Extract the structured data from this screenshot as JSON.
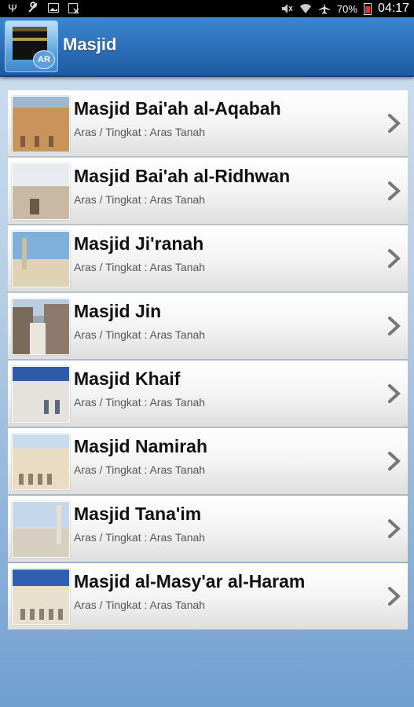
{
  "status_bar": {
    "battery": "70%",
    "time": "04:17",
    "icons": [
      "usb-icon",
      "wrench-icon",
      "image-icon",
      "calendar-x-icon",
      "mute-icon",
      "wifi-icon",
      "airplane-icon",
      "battery-icon"
    ]
  },
  "app_bar": {
    "title": "Masjid",
    "icon_badge": "AR"
  },
  "list": {
    "subtitle_label": "Aras / Tingkat : Aras Tanah",
    "items": [
      {
        "title": "Masjid Bai'ah al-Aqabah",
        "subtitle": "Aras / Tingkat : Aras Tanah"
      },
      {
        "title": "Masjid Bai'ah al-Ridhwan",
        "subtitle": "Aras / Tingkat : Aras Tanah"
      },
      {
        "title": "Masjid Ji'ranah",
        "subtitle": "Aras / Tingkat : Aras Tanah"
      },
      {
        "title": "Masjid Jin",
        "subtitle": "Aras / Tingkat : Aras Tanah"
      },
      {
        "title": "Masjid Khaif",
        "subtitle": "Aras / Tingkat : Aras Tanah"
      },
      {
        "title": "Masjid Namirah",
        "subtitle": "Aras / Tingkat : Aras Tanah"
      },
      {
        "title": "Masjid Tana'im",
        "subtitle": "Aras / Tingkat : Aras Tanah"
      },
      {
        "title": "Masjid al-Masy'ar al-Haram",
        "subtitle": "Aras / Tingkat : Aras Tanah"
      }
    ]
  },
  "colors": {
    "app_bar": "#2a6fb8",
    "status_bar": "#000000",
    "background": "#b9cfe6"
  }
}
